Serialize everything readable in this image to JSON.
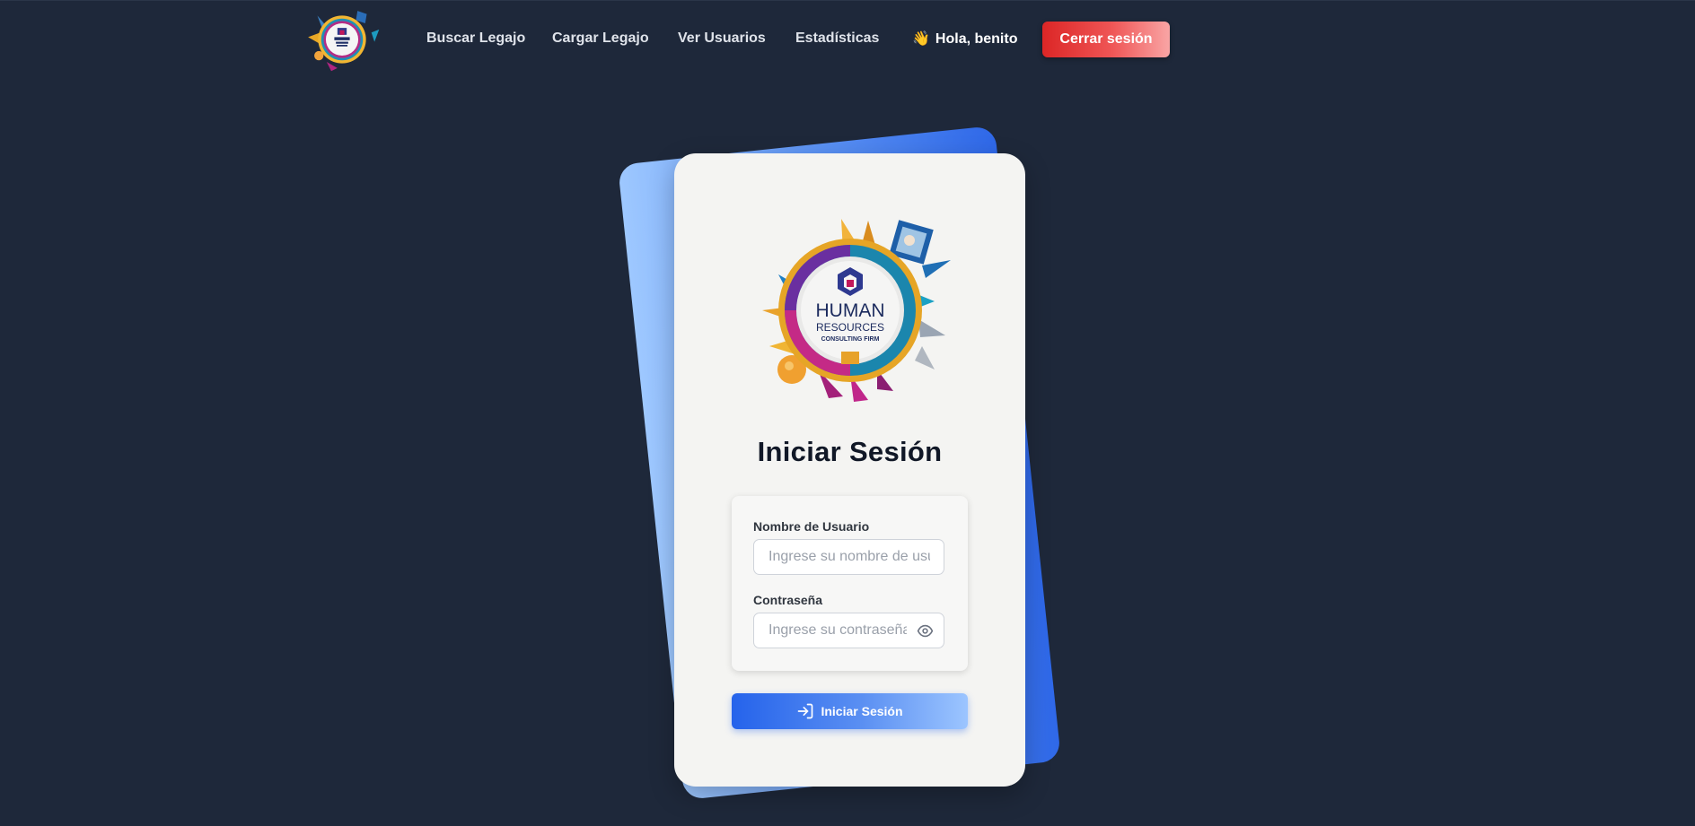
{
  "header": {
    "logo_icon": "human-resources-logo-icon",
    "nav": [
      {
        "label": "Buscar Legajo"
      },
      {
        "label": "Cargar Legajo"
      },
      {
        "label": "Ver Usuarios"
      },
      {
        "label": "Estadísticas"
      }
    ],
    "greeting_emoji": "👋",
    "greeting": "Hola, benito",
    "logout_label": "Cerrar sesión"
  },
  "login": {
    "logo_icon": "human-resources-logo-icon",
    "logo_text": [
      "HUMAN",
      "RESOURCES",
      "CONSULTING FIRM"
    ],
    "title": "Iniciar Sesión",
    "username": {
      "label": "Nombre de Usuario",
      "placeholder": "Ingrese su nombre de usuario",
      "value": ""
    },
    "password": {
      "label": "Contraseña",
      "placeholder": "Ingrese su contraseña",
      "value": "",
      "toggle_icon": "eye-icon"
    },
    "submit_label": "Iniciar Sesión",
    "submit_icon": "login-arrow-icon"
  },
  "colors": {
    "page_background": "#1e283a",
    "card_background": "#f4f4f2",
    "primary_blue": "#2563eb",
    "light_blue": "#9cc5ff",
    "logout_red": "#dc2626"
  }
}
